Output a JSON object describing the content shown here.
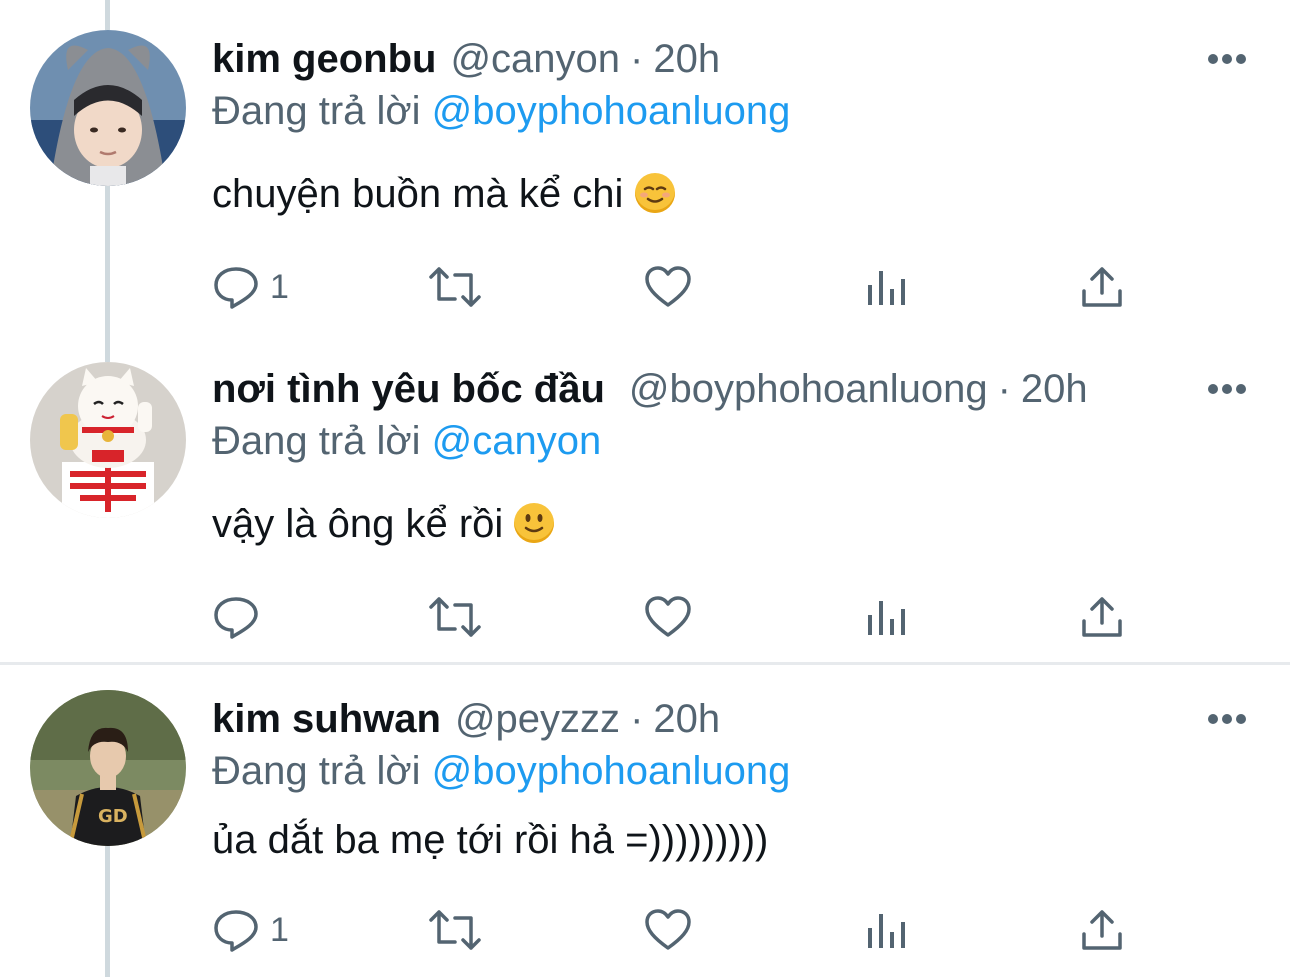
{
  "tweets": [
    {
      "name": "kim geonbu",
      "handle": "@canyon",
      "dot": "·",
      "time": "20h",
      "reply_prefix": "Đang trả lời",
      "reply_mention": "@boyphohoanluong",
      "text": "chuyện buồn mà kể chi",
      "emoji": "relieved-face",
      "reply_count": "1",
      "retweet_count": "",
      "like_count": ""
    },
    {
      "name": "nơi tình yêu bốc đầu",
      "handle": "@boyphohoanluong",
      "dot": "·",
      "time": "20h",
      "reply_prefix": "Đang trả lời",
      "reply_mention": "@canyon",
      "text": "vậy là ông kể rồi",
      "emoji": "slightly-smiling-face",
      "reply_count": "",
      "retweet_count": "",
      "like_count": ""
    },
    {
      "name": "kim suhwan",
      "handle": "@peyzzz",
      "dot": "·",
      "time": "20h",
      "reply_prefix": "Đang trả lời",
      "reply_mention": "@boyphohoanluong",
      "text": "ủa dắt ba mẹ tới rồi hả =)))))))))",
      "emoji": "",
      "reply_count": "1",
      "retweet_count": "",
      "like_count": ""
    }
  ],
  "colors": {
    "text": "#0f1419",
    "secondary": "#536471",
    "link": "#1d9bf0",
    "thread_line": "#cfd9de",
    "divider": "#e7eaed"
  },
  "icons": [
    "reply-icon",
    "retweet-icon",
    "like-icon",
    "views-icon",
    "share-icon",
    "more-icon"
  ]
}
